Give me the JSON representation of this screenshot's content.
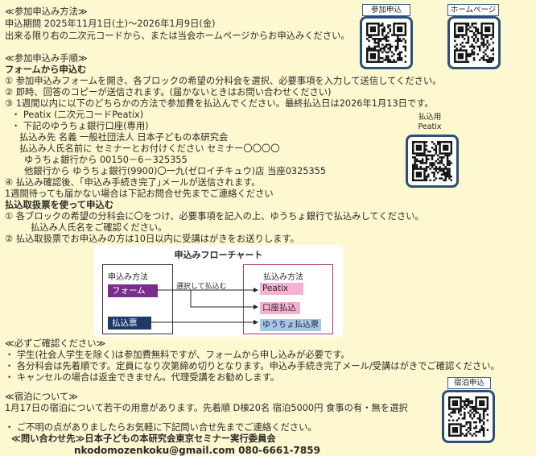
{
  "method": {
    "heading": "≪参加申込み方法≫",
    "period": "申込期間  2025年11月1日(土)～2026年1月9日(金)",
    "desc": "出来る限り右の二次元コードから、または当会ホームページからお申込みください。"
  },
  "steps": {
    "heading": "≪参加申込み手順≫",
    "form_heading": "フォームから申込む",
    "s1": "①    参加申込みフォームを開き、各ブロックの希望の分科会を選択、必要事項を入力して送信してください。",
    "s2": "②    即時、回答のコピーが送信されます。(届かないときはお問い合わせください)",
    "s3": "③    1週間以内に以下のどちらかの方法で参加費を払込んでください。最終払込日は2026年1月13日です。",
    "peatix": "・ Peatix          (二次元コードPeatix)",
    "bank_intro": "・ 下記のゆうちょ銀行口座(専用)",
    "payee": "払込み先  名義  一般社団法人  日本子どもの本研究会",
    "payer": "払込み人氏名前に  セミナーとお付けください  セミナー〇〇〇〇",
    "yucho": "ゆうちょ銀行から  00150－6－325355",
    "other": "他銀行から          ゆうちょ銀行(9900)〇一九(ゼロイチキュウ)店  当座0325355",
    "s4": "④    払込み確認後、｢申込み手続き完了｣メールが送信されます。",
    "s4b": "1週間待っても届かない場合は下記お問合せ先までご連絡ください",
    "slip_heading": "払込取扱票を使って申込む",
    "p1": "①    各ブロックの希望の分科会に〇をつけ、必要事項を記入の上、ゆうちょ銀行で払込みしてください。",
    "p1b": "払込み人氏名をご確認ください。",
    "p2": "②    払込取扱票でお申込みの方は10日以内に受講はがきをお送りします。"
  },
  "flow": {
    "title": "申込みフローチャート",
    "left_head": "申込み方法",
    "form": "フォーム",
    "slip": "払込票",
    "arrow": "選択して払込む",
    "right_head": "払込み方法",
    "peatix": "Peatix",
    "account": "口座払込",
    "yucho_slip": "ゆうちょ払込票"
  },
  "confirm": {
    "heading": "≪必ずご確認ください≫",
    "c1": "・ 学生(社会人学生を除く)は参加費無料ですが、フォームから申し込みが必要です。",
    "c2": "・ 各分科会は先着順です。定員になり次第締め切りとなります。申込み手続き完了メール/受講はがきでご確認ください。",
    "c3": "・ キャンセルの場合は返金できません。代理受講をお勧めします。"
  },
  "lodging": {
    "heading": "≪宿泊について≫",
    "desc": "1月17日の宿泊について若干の用意があります。先着順  D棟20名  宿泊5000円  食事の有・無を選択"
  },
  "contact": {
    "note": "・ ご不明の点がありましたらお気軽に下記問い合せ先までご連絡ください。",
    "org": "≪問い合わせ先≫日本子どもの本研究会東京セミナー実行委員会",
    "info": "nkodomozenkoku@gmail.com  080-6661-7859"
  },
  "qr": {
    "apply": "参加申込",
    "home": "ホームページ",
    "peatix_l1": "払込用",
    "peatix_l2": "Peatix",
    "lodging": "宿泊申込"
  }
}
